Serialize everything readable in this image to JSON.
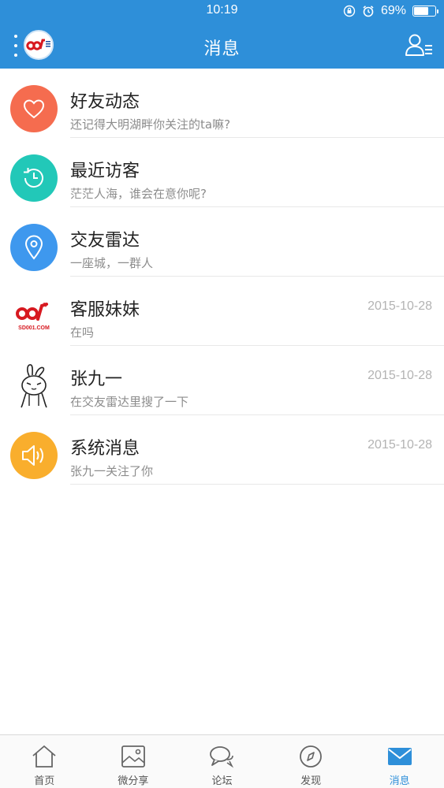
{
  "status_bar": {
    "time": "10:19",
    "battery": "69%",
    "battery_level": 0.69
  },
  "header": {
    "title": "消息"
  },
  "logo": {
    "text": "SD001.COM"
  },
  "messages": [
    {
      "title": "好友动态",
      "subtitle": "还记得大明湖畔你关注的ta嘛?",
      "date": "",
      "icon": "heart-icon",
      "color": "#f56c4f"
    },
    {
      "title": "最近访客",
      "subtitle": "茫茫人海，谁会在意你呢?",
      "date": "",
      "icon": "history-clock-icon",
      "color": "#22c8b8"
    },
    {
      "title": "交友雷达",
      "subtitle": "一座城，一群人",
      "date": "",
      "icon": "location-pin-icon",
      "color": "#3e98ee"
    },
    {
      "title": "客服妹妹",
      "subtitle": "在吗",
      "date": "2015-10-28",
      "icon": "sd001-logo-icon",
      "color": "#ffffff"
    },
    {
      "title": "张九一",
      "subtitle": "在交友雷达里搜了一下",
      "date": "2015-10-28",
      "icon": "rabbit-avatar-icon",
      "color": "#ffffff"
    },
    {
      "title": "系统消息",
      "subtitle": "张九一关注了你",
      "date": "2015-10-28",
      "icon": "speaker-icon",
      "color": "#f9ae2d"
    }
  ],
  "tabs": [
    {
      "label": "首页",
      "icon": "home-icon",
      "active": false
    },
    {
      "label": "微分享",
      "icon": "image-icon",
      "active": false
    },
    {
      "label": "论坛",
      "icon": "chat-bubbles-icon",
      "active": false
    },
    {
      "label": "发现",
      "icon": "compass-icon",
      "active": false
    },
    {
      "label": "消息",
      "icon": "mail-icon",
      "active": true
    }
  ],
  "colors": {
    "accent": "#2e8fd9",
    "tab_inactive": "#555555"
  }
}
